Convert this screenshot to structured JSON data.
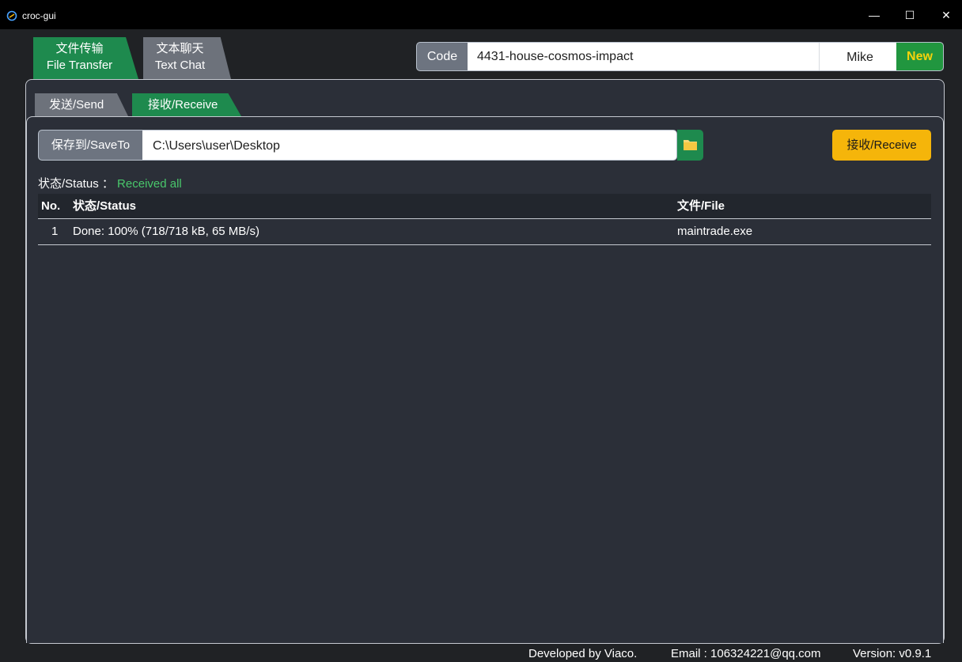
{
  "window": {
    "title": "croc-gui",
    "controls": {
      "minimize": "—",
      "maximize": "☐",
      "close": "✕"
    }
  },
  "main_tabs": [
    {
      "line1": "文件传输",
      "line2": "File Transfer",
      "active": true
    },
    {
      "line1": "文本聊天",
      "line2": "Text Chat",
      "active": false
    }
  ],
  "code_bar": {
    "label": "Code",
    "code_value": "4431-house-cosmos-impact",
    "name_value": "Mike",
    "new_label": "New"
  },
  "sub_tabs": [
    {
      "label": "发送/Send",
      "active": false
    },
    {
      "label": "接收/Receive",
      "active": true
    }
  ],
  "save_to": {
    "label": "保存到/SaveTo",
    "path": "C:\\Users\\user\\Desktop",
    "folder_icon": "folder-icon"
  },
  "receive_button": "接收/Receive",
  "status": {
    "label": "状态/Status ：",
    "value": "Received all"
  },
  "table": {
    "headers": {
      "no": "No.",
      "status": "状态/Status",
      "file": "文件/File"
    },
    "rows": [
      {
        "no": "1",
        "status": "Done: 100% (718/718 kB, 65 MB/s)",
        "file": "maintrade.exe"
      }
    ]
  },
  "footer": {
    "developer": "Developed by Viaco.",
    "email": "Email : 106324221@qq.com",
    "version": "Version: v0.9.1"
  },
  "colors": {
    "accent_green": "#1e8a4e",
    "accent_yellow": "#f5b50a",
    "status_green": "#49c76b",
    "panel_bg": "#2b2f38"
  }
}
